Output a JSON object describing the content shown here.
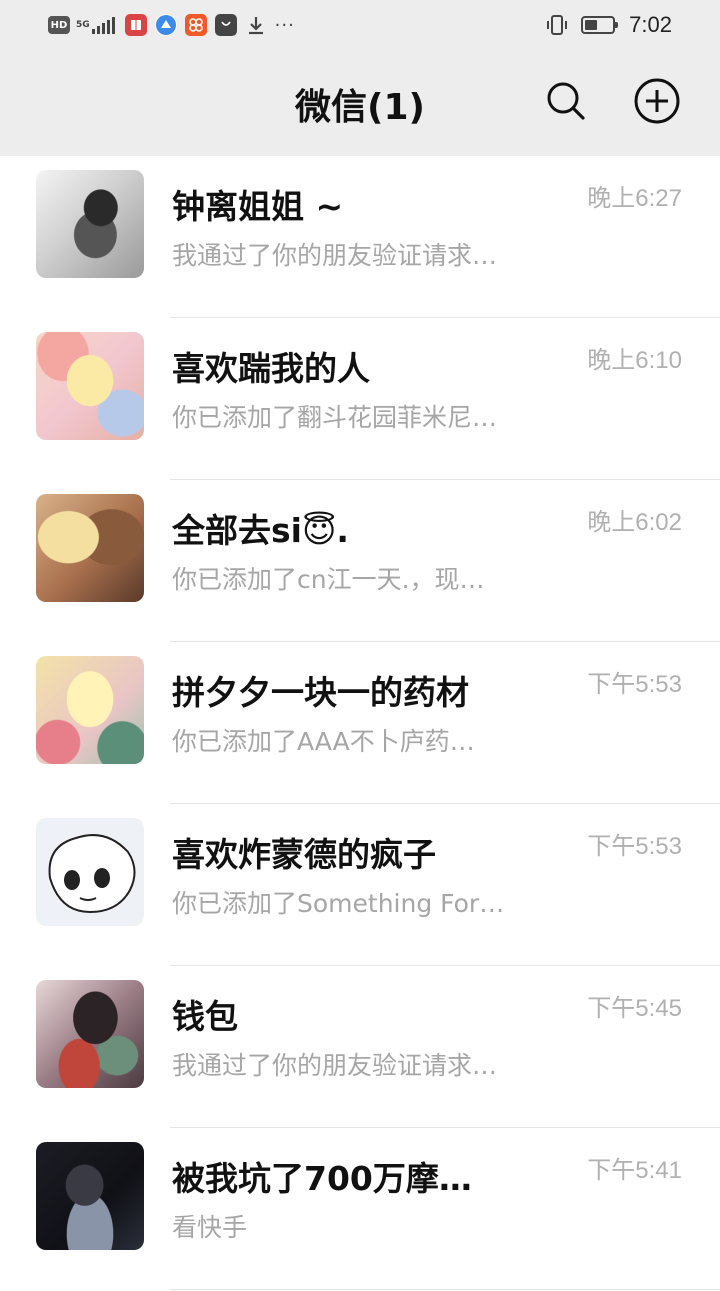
{
  "status_bar": {
    "hd": "HD",
    "network": "5G",
    "time": "7:02",
    "battery_level": 0.45,
    "more": "···"
  },
  "header": {
    "title": "微信(1)"
  },
  "chats": [
    {
      "name": "钟离姐姐 ~",
      "preview": "我通过了你的朋友验证请求…",
      "time": "晚上6:27"
    },
    {
      "name": "喜欢踹我的人",
      "preview": "你已添加了翻斗花园菲米尼…",
      "time": "晚上6:10"
    },
    {
      "name": "全部去si😇.",
      "preview": "你已添加了cn江一天.，现…",
      "time": "晚上6:02"
    },
    {
      "name": "拼夕夕一块一的药材",
      "preview": "你已添加了AAA不卜庐药…",
      "time": "下午5:53"
    },
    {
      "name": "喜欢炸蒙德的疯子",
      "preview": "你已添加了Something For…",
      "time": "下午5:53"
    },
    {
      "name": "钱包",
      "preview": "我通过了你的朋友验证请求…",
      "time": "下午5:45"
    },
    {
      "name": "被我坑了700万摩…",
      "preview": "看快手",
      "time": "下午5:41"
    }
  ],
  "colors": {
    "header_bg": "#ededed",
    "name_text": "#111111",
    "preview_text": "#a6a6a6",
    "time_text": "#b0b0b0",
    "divider": "#e5e5e5"
  }
}
